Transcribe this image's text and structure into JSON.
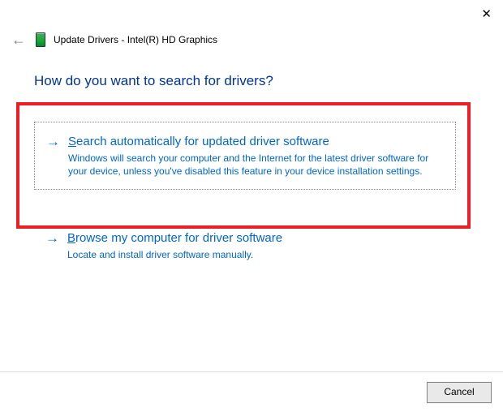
{
  "window": {
    "close_glyph": "✕",
    "back_glyph": "←",
    "title": "Update Drivers - Intel(R) HD Graphics"
  },
  "heading": "How do you want to search for drivers?",
  "options": [
    {
      "arrow": "→",
      "title_accel": "S",
      "title_rest": "earch automatically for updated driver software",
      "desc": "Windows will search your computer and the Internet for the latest driver software for your device, unless you've disabled this feature in your device installation settings."
    },
    {
      "arrow": "→",
      "title_accel": "B",
      "title_rest": "rowse my computer for driver software",
      "desc": "Locate and install driver software manually."
    }
  ],
  "footer": {
    "cancel_label": "Cancel"
  },
  "annotation": {
    "highlight_color": "#ee1c25"
  }
}
